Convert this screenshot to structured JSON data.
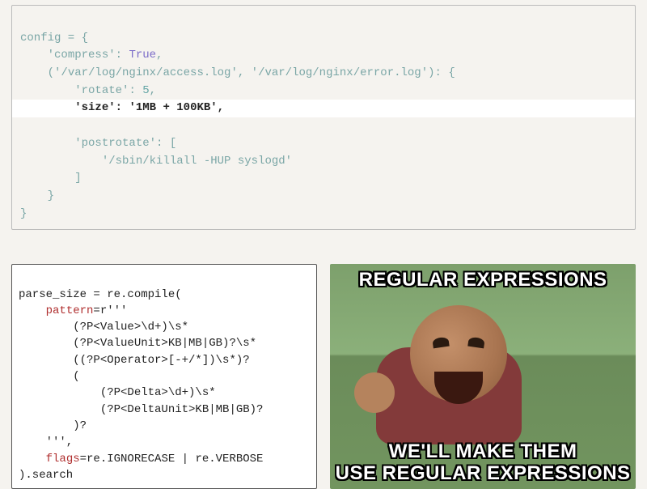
{
  "config_code": {
    "l1": "config = {",
    "l2_key": "'compress'",
    "l2_val": "True",
    "l3_tuple_a": "'/var/log/nginx/access.log'",
    "l3_tuple_b": "'/var/log/nginx/error.log'",
    "l4_key": "'rotate'",
    "l4_val": "5",
    "l5_key": "'size'",
    "l5_val": "'1MB + 100KB'",
    "l6_key": "'postrotate'",
    "l7_item": "'/sbin/killall -HUP syslogd'",
    "l8": "        ]",
    "l9": "    }",
    "l10": "}"
  },
  "regex_code": {
    "l1a": "parse_size = re.compile(",
    "l2a": "    ",
    "l2_kw": "pattern",
    "l2b": "=r'''",
    "l3": "        (?P<Value>\\d+)\\s*",
    "l4": "        (?P<ValueUnit>KB|MB|GB)?\\s*",
    "l5": "        ((?P<Operator>[-+/*])\\s*)?",
    "l6": "        (",
    "l7": "            (?P<Delta>\\d+)\\s*",
    "l8": "            (?P<DeltaUnit>KB|MB|GB)?",
    "l9": "        )?",
    "l10": "    ''',",
    "l11a": "    ",
    "l11_kw": "flags",
    "l11b": "=re.IGNORECASE | re.VERBOSE",
    "l12": ").search"
  },
  "meme": {
    "top": "REGULAR EXPRESSIONS",
    "bottom_l1": "WE'LL MAKE THEM",
    "bottom_l2": "USE REGULAR EXPRESSIONS"
  }
}
